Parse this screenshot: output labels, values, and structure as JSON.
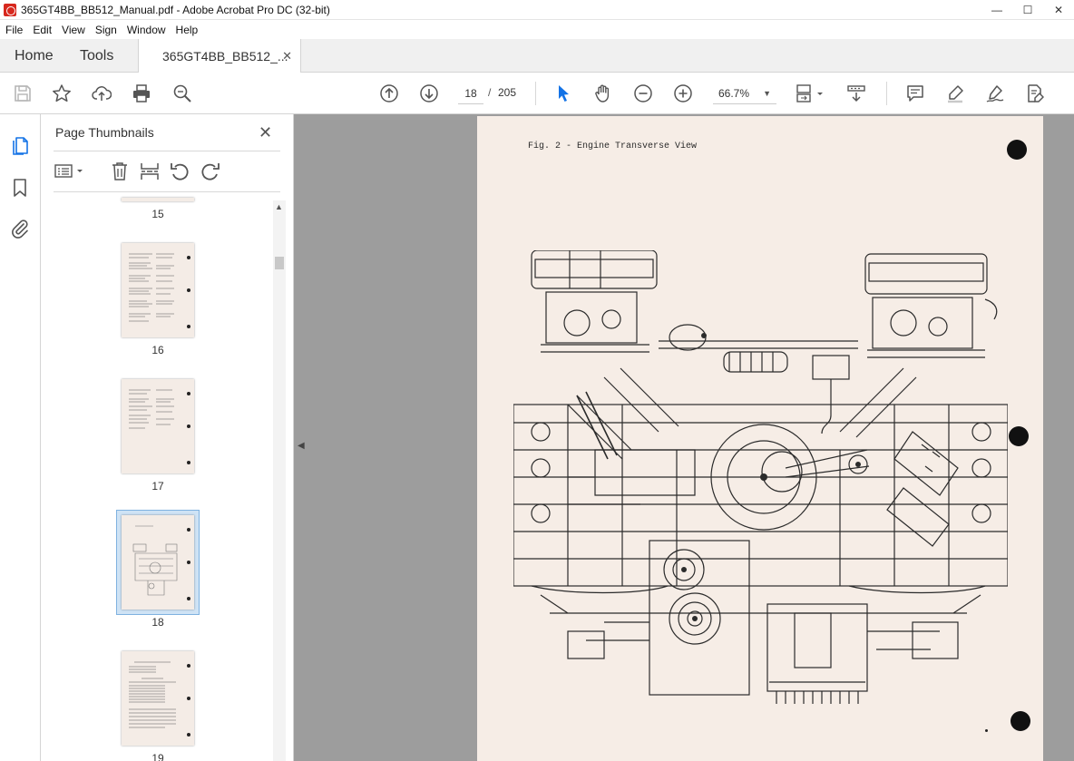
{
  "window": {
    "title": "365GT4BB_BB512_Manual.pdf - Adobe Acrobat Pro DC (32-bit)"
  },
  "menu": [
    "File",
    "Edit",
    "View",
    "Sign",
    "Window",
    "Help"
  ],
  "tabs": {
    "home": "Home",
    "tools": "Tools",
    "document": "365GT4BB_BB512_..."
  },
  "toolbar": {
    "current_page": "18",
    "page_separator": "/",
    "total_pages": "205",
    "zoom": "66.7%"
  },
  "thumbnails_panel": {
    "title": "Page Thumbnails",
    "pages": [
      "15",
      "16",
      "17",
      "18",
      "19"
    ],
    "selected_page": "18"
  },
  "document": {
    "figure_caption": "Fig. 2 - Engine Transverse View"
  },
  "colors": {
    "accent_blue": "#1473e6",
    "selection": "#cfe3f5",
    "paper": "#f6ede6",
    "workspace": "#9d9d9d",
    "acrobat_red": "#d7281e"
  }
}
